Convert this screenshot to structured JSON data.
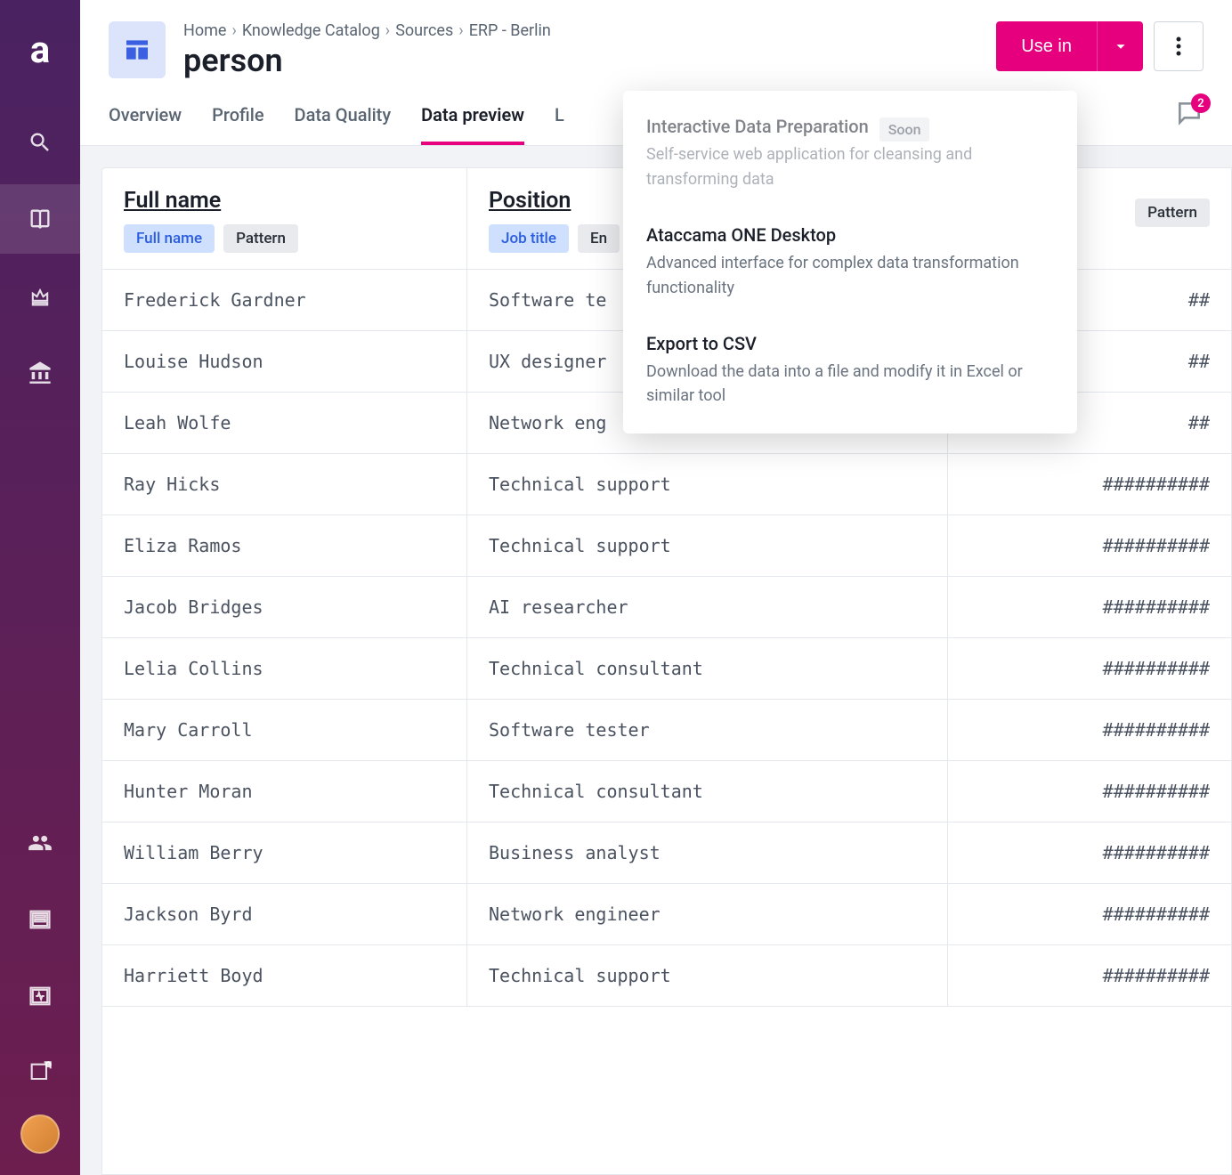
{
  "breadcrumb": [
    "Home",
    "Knowledge Catalog",
    "Sources",
    "ERP - Berlin"
  ],
  "page_title": "person",
  "use_in_label": "Use in",
  "comments_count": "2",
  "tabs": [
    "Overview",
    "Profile",
    "Data Quality",
    "Data preview",
    "L"
  ],
  "active_tab_index": 3,
  "popover": {
    "items": [
      {
        "title": "Interactive Data Preparation",
        "badge": "Soon",
        "desc": "Self-service web application for cleansing and transforming data",
        "disabled": true
      },
      {
        "title": "Ataccama ONE Desktop",
        "badge": "",
        "desc": "Advanced interface for complex data transformation functionality",
        "disabled": false
      },
      {
        "title": "Export to CSV",
        "badge": "",
        "desc": "Download the data into a file and modify it in Excel or similar tool",
        "disabled": false
      }
    ]
  },
  "columns": [
    {
      "name": "Full name",
      "chips": [
        {
          "text": "Full name",
          "style": "blue"
        },
        {
          "text": "Pattern",
          "style": "gray"
        }
      ]
    },
    {
      "name": "Position",
      "chips": [
        {
          "text": "Job title",
          "style": "blue"
        },
        {
          "text": "En",
          "style": "gray"
        }
      ]
    },
    {
      "name": "",
      "chips": [
        {
          "text": "Pattern",
          "style": "gray"
        }
      ]
    }
  ],
  "rows": [
    [
      "Frederick Gardner",
      "Software te",
      "##"
    ],
    [
      "Louise Hudson",
      "UX designer",
      "##"
    ],
    [
      "Leah Wolfe",
      "Network eng",
      "##"
    ],
    [
      "Ray Hicks",
      "Technical support",
      "##########"
    ],
    [
      "Eliza Ramos",
      "Technical support",
      "##########"
    ],
    [
      "Jacob Bridges",
      "AI researcher",
      "##########"
    ],
    [
      "Lelia Collins",
      "Technical consultant",
      "##########"
    ],
    [
      "Mary Carroll",
      "Software tester",
      "##########"
    ],
    [
      "Hunter Moran",
      "Technical consultant",
      "##########"
    ],
    [
      "William Berry",
      "Business analyst",
      "##########"
    ],
    [
      "Jackson Byrd",
      "Network engineer",
      "##########"
    ],
    [
      "Harriett Boyd",
      "Technical support",
      "##########"
    ]
  ]
}
